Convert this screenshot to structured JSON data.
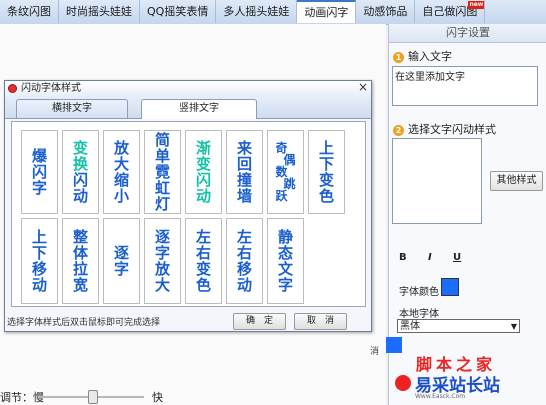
{
  "top_tabs": [
    {
      "label": "条纹闪图"
    },
    {
      "label": "时尚摇头娃娃"
    },
    {
      "label": "QQ摇笑表情"
    },
    {
      "label": "多人摇头娃娃"
    },
    {
      "label": "动画闪字"
    },
    {
      "label": "动感饰品"
    },
    {
      "label": "自己做闪图",
      "badge": "new"
    }
  ],
  "active_tab_index": 4,
  "right_panel": {
    "header": "闪字设置",
    "step1_num": "1",
    "step1_label": "输入文字",
    "text_value": "在这里添加文字",
    "step2_num": "2",
    "step2_label": "选择文字闪动样式",
    "other_style_button": "其他样式",
    "bold": "B",
    "italic": "I",
    "underline": "U",
    "font_color_label": "字体颜色",
    "font_color": "#1c6cff",
    "local_font_label": "本地字体",
    "local_font_value": "黑体",
    "side_label": "消"
  },
  "speed": {
    "label": "调节：慢",
    "fast_label": "快",
    "level": 0.5
  },
  "dialog": {
    "title": "闪动字体样式",
    "tab_horizontal": "横排文字",
    "tab_vertical": "竖排文字",
    "row1": [
      "爆闪字",
      "变换闪动",
      "放大缩小",
      "简单霓虹灯",
      "渐变闪动",
      "来回撞墙",
      "奇偶数跳跃",
      "上下变色"
    ],
    "row2": [
      "上下移动",
      "整体拉宽",
      "逐字",
      "逐字放大",
      "左右变色",
      "左右移动",
      "静态文字"
    ],
    "status": "选择字体样式后双击鼠标即可完成选择",
    "ok": "确　定",
    "cancel": "取　消"
  },
  "watermark": {
    "line1": "脚本之家",
    "line2": "易采站长站",
    "url": "Www.Easck.Com"
  }
}
